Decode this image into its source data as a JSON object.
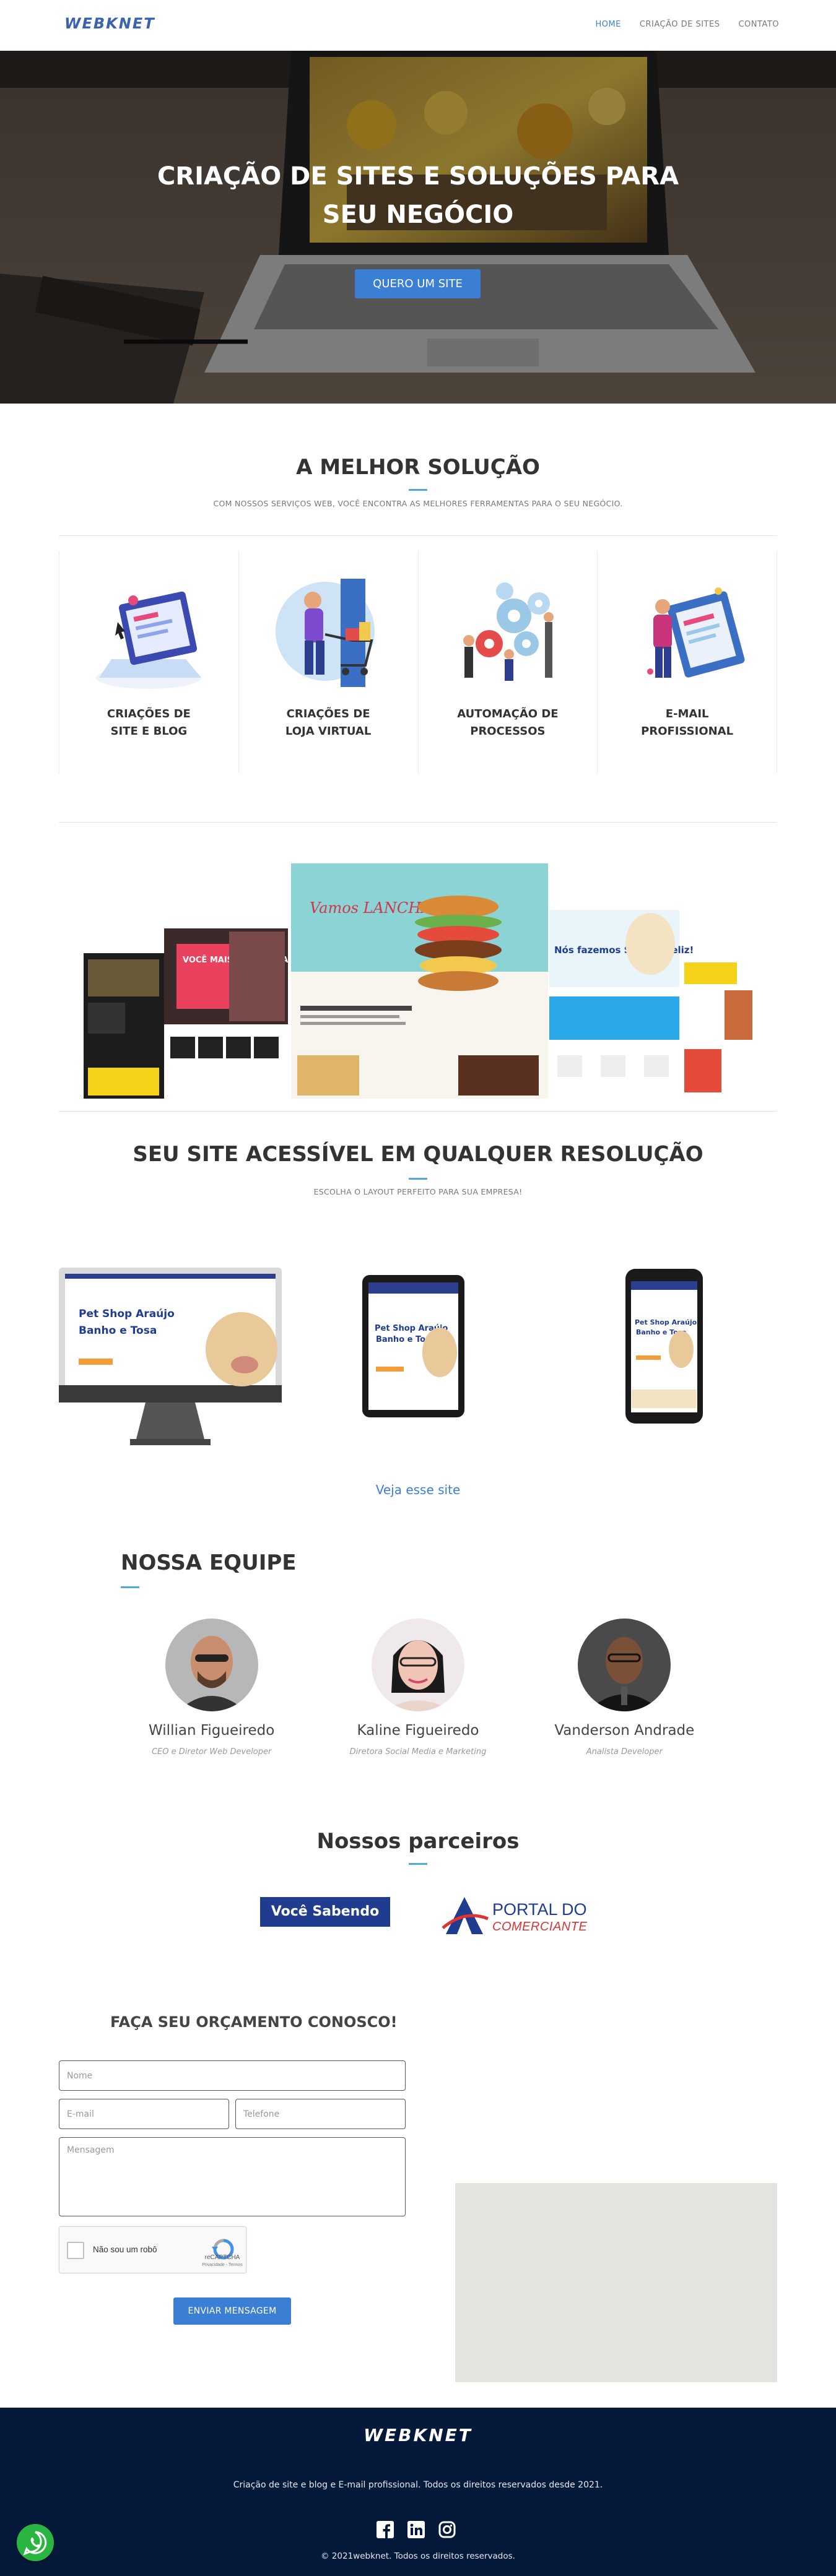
{
  "brand": {
    "logo": "WEBKNET",
    "accent": "#3b7fd4",
    "footer_bg": "#051a3a"
  },
  "nav": {
    "items": [
      {
        "label": "HOME",
        "active": true
      },
      {
        "label": "CRIAÇÃO DE SITES",
        "active": false
      },
      {
        "label": "CONTATO",
        "active": false
      }
    ]
  },
  "hero": {
    "title": "CRIAÇÃO DE SITES E SOLUÇÕES PARA SEU NEGÓCIO",
    "button": "QUERO UM SITE"
  },
  "solutions": {
    "title": "A MELHOR SOLUÇÃO",
    "subtitle": "COM NOSSOS SERVIÇOS WEB, VOCÊ ENCONTRA AS MELHORES FERRAMENTAS PARA O SEU NEGÓCIO.",
    "items": [
      {
        "label": "CRIAÇÕES DE\nSITE E BLOG",
        "icon": "laptop-blog-illustration"
      },
      {
        "label": "CRIAÇÕES DE\nLOJA VIRTUAL",
        "icon": "shopping-cart-illustration"
      },
      {
        "label": "AUTOMAÇÃO DE\nPROCESSOS",
        "icon": "gears-automation-illustration"
      },
      {
        "label": "E-MAIL\nPROFISSIONAL",
        "icon": "email-illustration"
      }
    ]
  },
  "collage": {
    "center_title": "Vamos LANCHAR",
    "right_title": "Nós fazemos Seu pet feliz!",
    "left_title": "VOCÊ MAIS FORTE AMANHÃ!"
  },
  "responsive": {
    "title": "SEU SITE ACESSÍVEL EM QUALQUER RESOLUÇÃO",
    "subtitle": "ESCOLHA O LAYOUT PERFEITO PARA SUA EMPRESA!",
    "device_title_1": "Pet Shop Araújo",
    "device_title_2": "Banho e Tosa",
    "link": "Veja esse site"
  },
  "team": {
    "title": "NOSSA EQUIPE",
    "members": [
      {
        "name": "Willian Figueiredo",
        "role": "CEO e Diretor Web Developer"
      },
      {
        "name": "Kaline Figueiredo",
        "role": "Diretora Social Media e Marketing"
      },
      {
        "name": "Vanderson Andrade",
        "role": "Analista Developer"
      }
    ]
  },
  "partners": {
    "title": "Nossos parceiros",
    "items": [
      {
        "name": "Você Sabendo"
      },
      {
        "name_line1": "PORTAL DO",
        "name_line2": "COMERCIANTE"
      }
    ]
  },
  "contact": {
    "title": "FAÇA SEU ORÇAMENTO CONOSCO!",
    "name_placeholder": "Nome",
    "email_placeholder": "E-mail",
    "phone_placeholder": "Telefone",
    "message_placeholder": "Mensagem",
    "recaptcha_label": "Não sou um robô",
    "recaptcha_brand": "reCAPTCHA",
    "recaptcha_terms": "Privacidade - Termos",
    "submit": "ENVIAR MENSAGEM"
  },
  "footer": {
    "logo": "WEBKNET",
    "text": "Criação de site e blog e E-mail profissional. Todos os direitos reservados desde 2021.",
    "copyright": "© 2021webknet. Todos os direitos reservados.",
    "socials": [
      "facebook-icon",
      "linkedin-icon",
      "instagram-icon"
    ]
  }
}
